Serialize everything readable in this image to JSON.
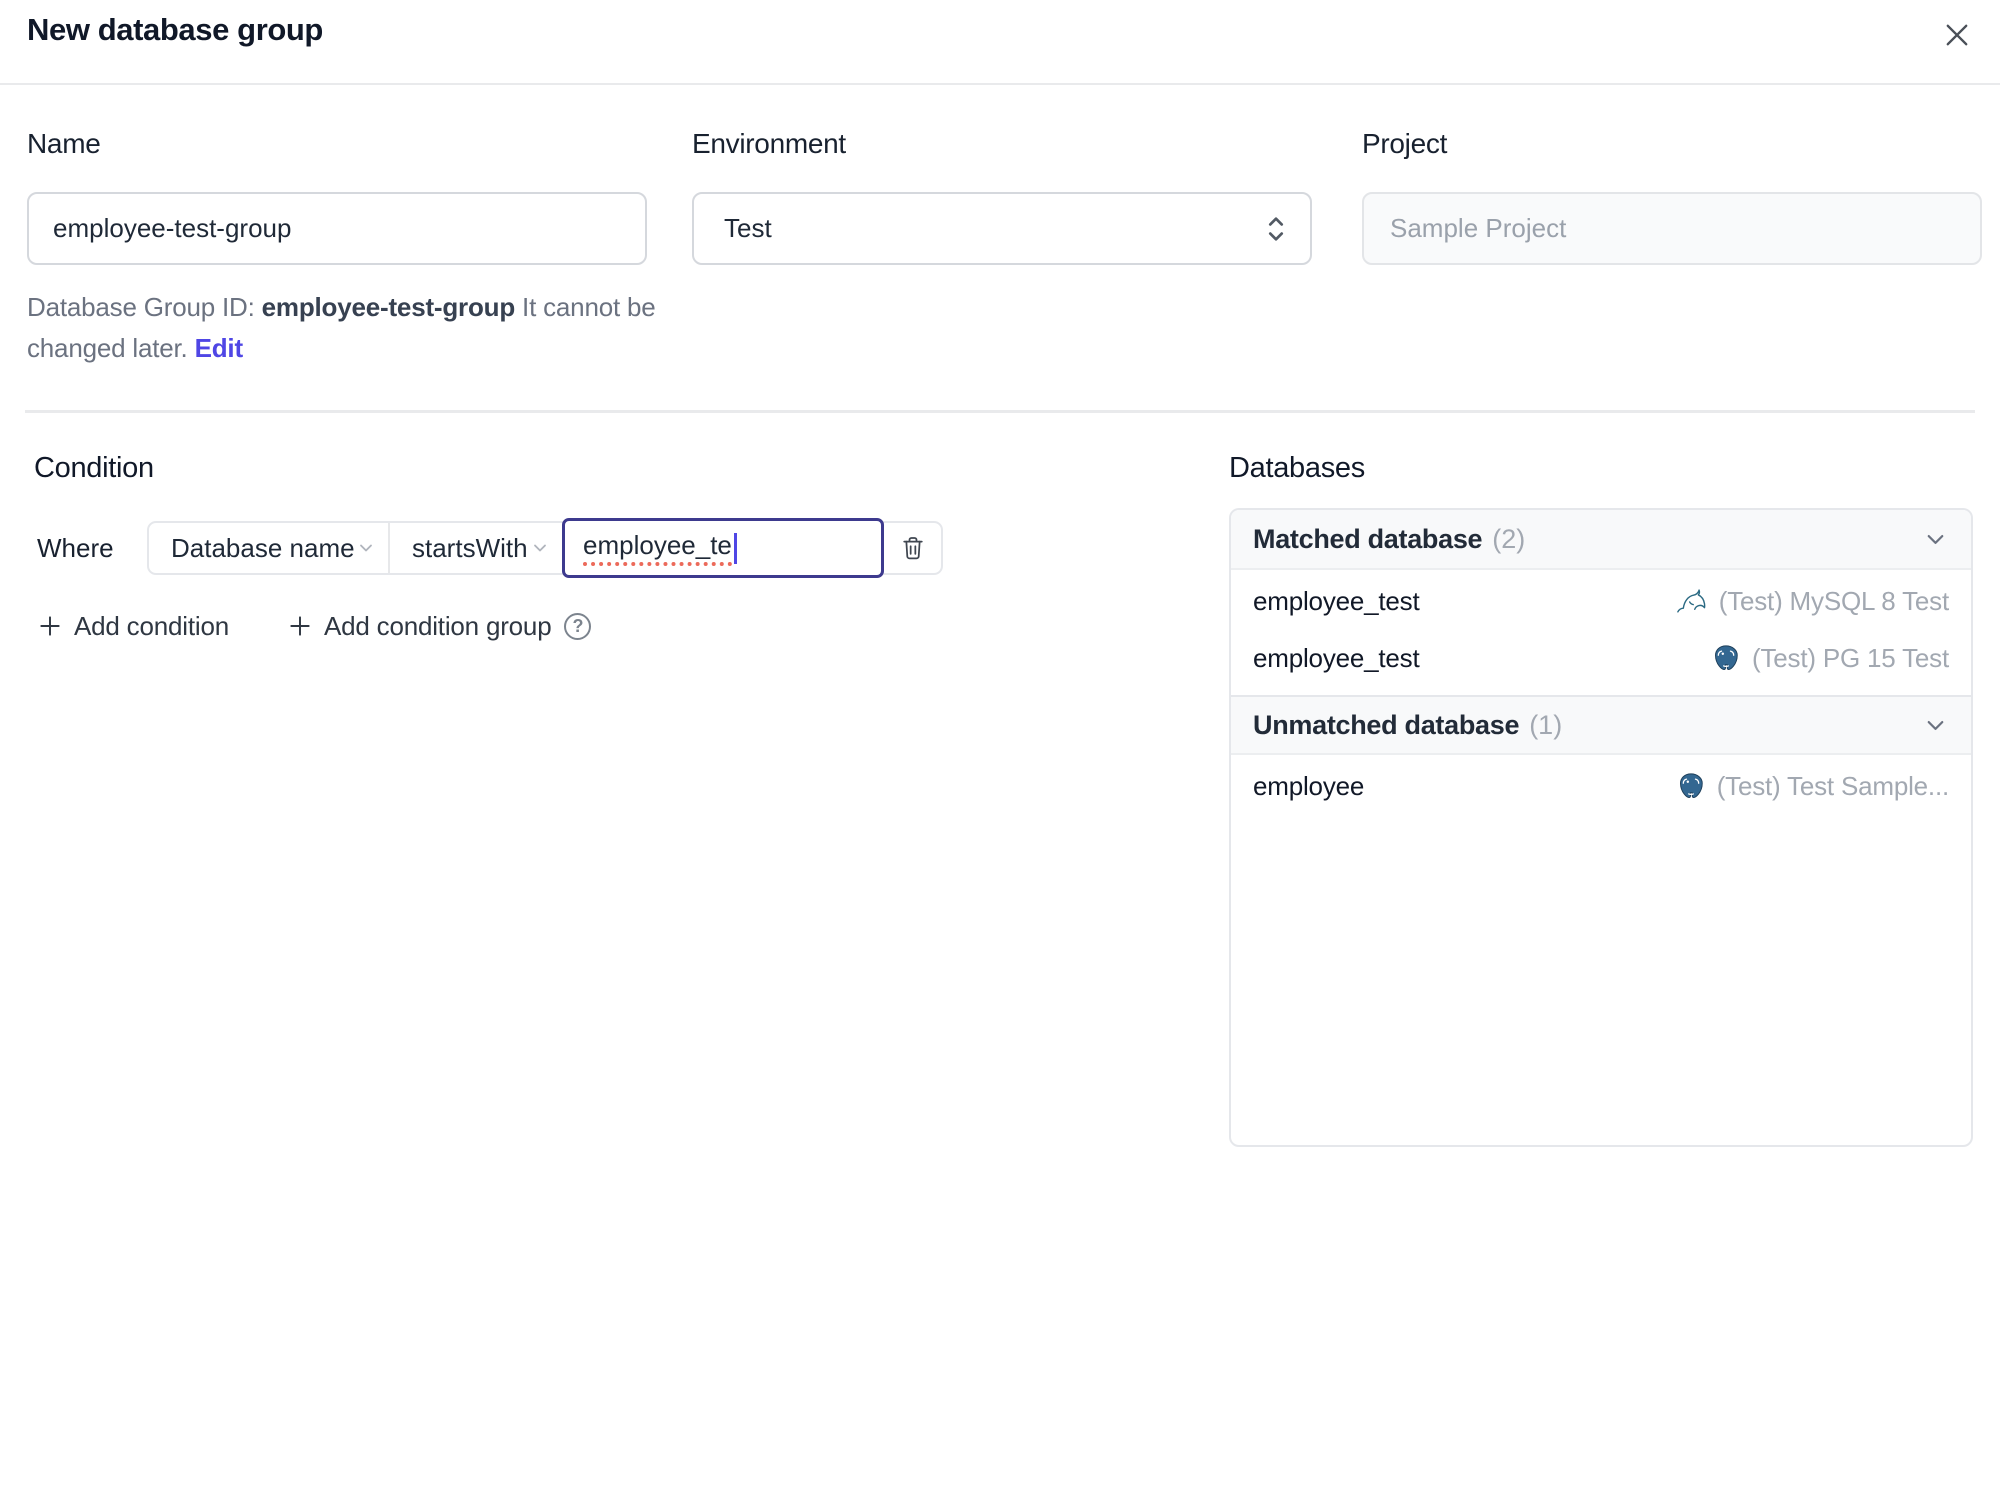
{
  "dialog": {
    "title": "New database group"
  },
  "form": {
    "name": {
      "label": "Name",
      "value": "employee-test-group"
    },
    "environment": {
      "label": "Environment",
      "value": "Test"
    },
    "project": {
      "label": "Project",
      "value": "Sample Project"
    },
    "group_id": {
      "prefix": "Database Group ID:",
      "value": "employee-test-group",
      "note": "It cannot be changed later.",
      "edit_label": "Edit"
    }
  },
  "condition": {
    "heading": "Condition",
    "where_label": "Where",
    "field": "Database name",
    "operator": "startsWith",
    "value": "employee_te",
    "add_condition": "Add condition",
    "add_condition_group": "Add condition group",
    "help_icon": "?"
  },
  "databases": {
    "heading": "Databases",
    "matched": {
      "title": "Matched database",
      "count": "(2)"
    },
    "unmatched": {
      "title": "Unmatched database",
      "count": "(1)"
    },
    "matched_rows": [
      {
        "name": "employee_test",
        "icon": "mysql-dolphin-icon",
        "instance": "(Test) MySQL 8 Test"
      },
      {
        "name": "employee_test",
        "icon": "postgresql-elephant-icon",
        "instance": "(Test) PG 15 Test"
      }
    ],
    "unmatched_rows": [
      {
        "name": "employee",
        "icon": "postgresql-elephant-icon",
        "instance": "(Test) Test Sample..."
      }
    ]
  },
  "colors": {
    "accent_indigo": "#4f46e5",
    "focus_border": "#3d3a8e",
    "border": "#e5e7eb",
    "input_border": "#d5d8dd",
    "text_primary": "#1f2937",
    "text_secondary": "#6b7280",
    "text_muted": "#9ca3af",
    "section_header_bg": "#f8f9fa",
    "spellcheck_red": "#ec6a5a",
    "mysql_teal": "#2b6a83",
    "postgres_blue": "#336791"
  }
}
